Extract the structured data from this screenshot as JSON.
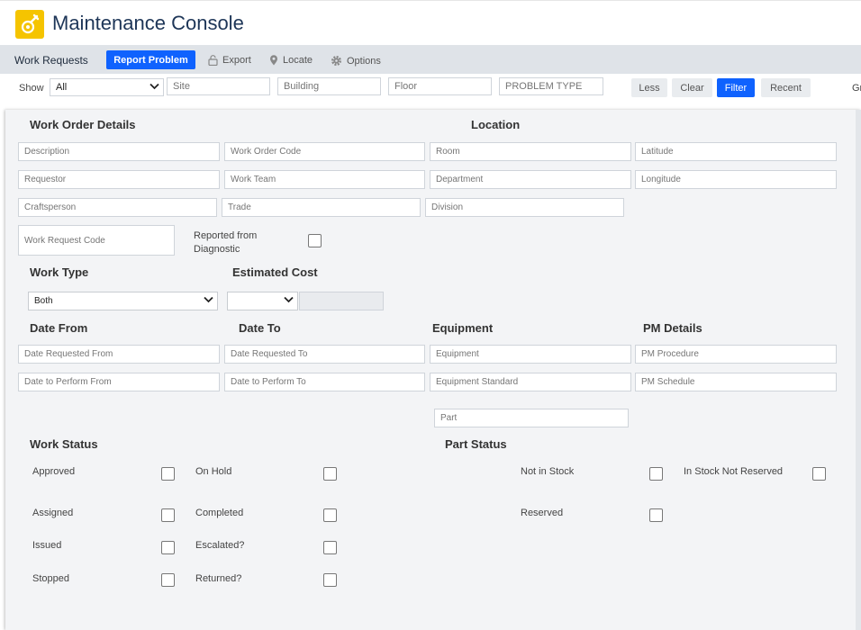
{
  "header": {
    "title": "Maintenance Console"
  },
  "toolbar": {
    "title": "Work Requests",
    "report_label": "Report Problem",
    "export_label": "Export",
    "locate_label": "Locate",
    "options_label": "Options"
  },
  "filter": {
    "show_label": "Show",
    "show_value": "All",
    "site_placeholder": "Site",
    "building_placeholder": "Building",
    "floor_placeholder": "Floor",
    "problem_placeholder": "PROBLEM TYPE",
    "less_label": "Less",
    "clear_label": "Clear",
    "filter_label": "Filter",
    "recent_label": "Recent",
    "overflow_text": "Gr"
  },
  "panel": {
    "work_order_details": "Work Order Details",
    "location": "Location",
    "fields": {
      "description": "Description",
      "work_order_code": "Work Order Code",
      "room": "Room",
      "latitude": "Latitude",
      "requestor": "Requestor",
      "work_team": "Work Team",
      "department": "Department",
      "longitude": "Longitude",
      "craftsperson": "Craftsperson",
      "trade": "Trade",
      "division": "Division",
      "work_request_code": "Work Request Code",
      "date_requested_from": "Date Requested From",
      "date_requested_to": "Date Requested To",
      "equipment": "Equipment",
      "pm_procedure": "PM Procedure",
      "date_to_perform_from": "Date to Perform From",
      "date_to_perform_to": "Date to Perform To",
      "equipment_standard": "Equipment Standard",
      "pm_schedule": "PM Schedule",
      "part": "Part"
    },
    "reported_from_diagnostic": "Reported from Diagnostic",
    "work_type": "Work Type",
    "work_type_value": "Both",
    "estimated_cost": "Estimated Cost",
    "estimated_cost_value": "",
    "date_from": "Date From",
    "date_to": "Date To",
    "equipment_heading": "Equipment",
    "pm_details": "PM Details",
    "work_status": "Work Status",
    "part_status": "Part Status",
    "status": {
      "approved": "Approved",
      "on_hold": "On Hold",
      "assigned": "Assigned",
      "completed": "Completed",
      "issued": "Issued",
      "escalated": "Escalated?",
      "stopped": "Stopped",
      "returned": "Returned?",
      "not_in_stock": "Not in Stock",
      "in_stock_not_reserved": "In Stock Not Reserved",
      "reserved": "Reserved"
    }
  },
  "colors": {
    "accent": "#0f62fe",
    "logo": "#f5c400",
    "toolbar": "#dfe3e8",
    "panel": "#f3f4f6"
  },
  "icons": {
    "logo": "wrench-gear-icon",
    "export": "lock-icon",
    "locate": "map-pin-icon",
    "options": "gear-icon"
  }
}
